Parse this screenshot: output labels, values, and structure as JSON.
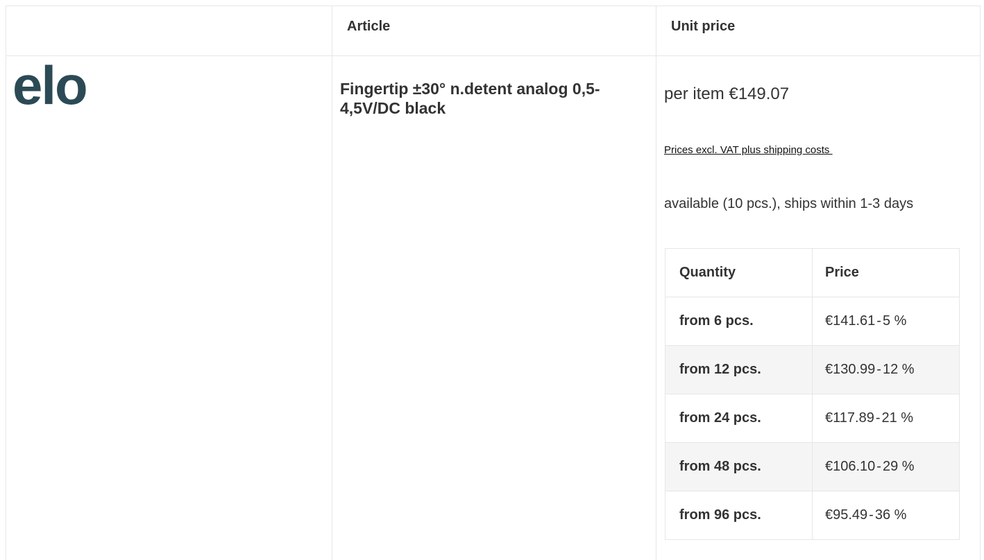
{
  "header": {
    "col_article": "Article",
    "col_unit_price": "Unit price"
  },
  "manufacturer": {
    "logo_text": "elo",
    "logo_color": "#2b4a55"
  },
  "article": {
    "name": "Fingertip ±30° n.detent analog 0,5-4,5V/DC black"
  },
  "pricing": {
    "unit_price_label": "per item €149.07",
    "vat_note": "Prices excl. VAT plus shipping costs ",
    "availability": "available (10 pcs.), ships within 1-3 days",
    "tier_table": {
      "col_quantity": "Quantity",
      "col_price": "Price",
      "rows": [
        {
          "qty": "from 6 pcs.",
          "price": "€141.61",
          "discount": "5 %"
        },
        {
          "qty": "from 12 pcs.",
          "price": "€130.99",
          "discount": "12 %"
        },
        {
          "qty": "from 24 pcs.",
          "price": "€117.89",
          "discount": "21 %"
        },
        {
          "qty": "from 48 pcs.",
          "price": "€106.10",
          "discount": "29 %"
        },
        {
          "qty": "from 96 pcs.",
          "price": "€95.49",
          "discount": "36 %"
        }
      ]
    }
  }
}
